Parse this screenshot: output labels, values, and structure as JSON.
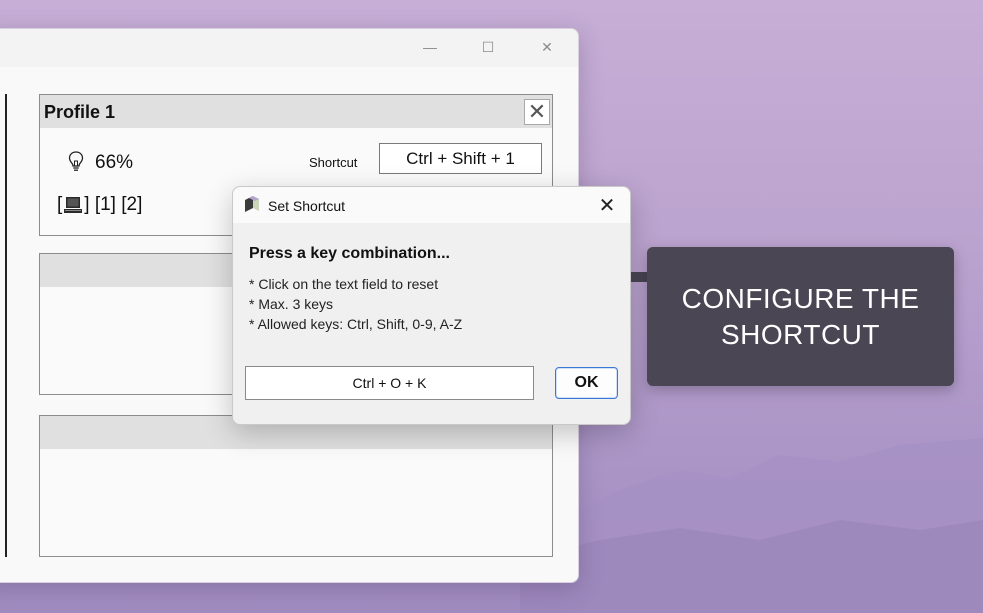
{
  "main_window": {
    "controls": {
      "minimize": "—",
      "maximize": "☐",
      "close": "✕"
    }
  },
  "profile_panel": {
    "title": "Profile 1",
    "close_glyph": "✕",
    "brightness": "66%",
    "shortcut_label": "Shortcut",
    "shortcut_value": "Ctrl + Shift + 1",
    "monitors": {
      "open": "[",
      "close": "]",
      "rest": " [1] [2]"
    },
    "icons": {
      "brightness": "lightbulb-icon",
      "monitor": "monitor-icon"
    }
  },
  "dialog": {
    "title": "Set Shortcut",
    "close_glyph": "✕",
    "heading": "Press a key combination...",
    "hints": [
      "* Click on the text field to reset",
      "* Max. 3 keys",
      "* Allowed keys: Ctrl, Shift, 0-9, A-Z"
    ],
    "key_input_value": "Ctrl + O + K",
    "ok_label": "OK"
  },
  "callout": {
    "text": "CONFIGURE THE SHORTCUT"
  },
  "colors": {
    "callout_bg": "#4a4654",
    "ok_border": "#3b78d6",
    "desktop": "#bba3cf"
  }
}
